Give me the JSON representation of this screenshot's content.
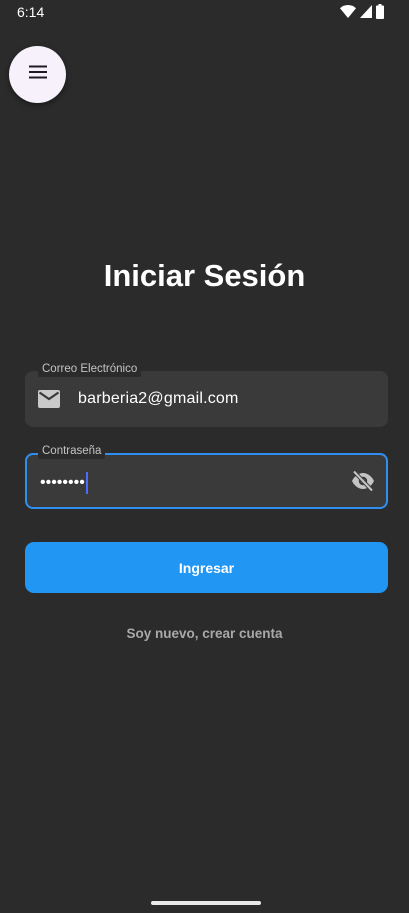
{
  "status_bar": {
    "time": "6:14",
    "icons": [
      "wifi-icon",
      "signal-icon",
      "battery-icon"
    ]
  },
  "menu_button": {
    "icon": "hamburger-menu-icon"
  },
  "title": "Iniciar Sesión",
  "email_field": {
    "label": "Correo Electrónico",
    "value": "barberia2@gmail.com",
    "icon": "mail-icon"
  },
  "password_field": {
    "label": "Contraseña",
    "value": "••••••••",
    "icon": "visibility-off-icon",
    "focused": true
  },
  "login_button": {
    "label": "Ingresar"
  },
  "register_link": {
    "label": "Soy nuevo, crear cuenta"
  },
  "colors": {
    "background": "#2b2b2b",
    "field_background": "#3a3a3a",
    "accent": "#2196f3",
    "focus_border": "#2f8ff0"
  }
}
